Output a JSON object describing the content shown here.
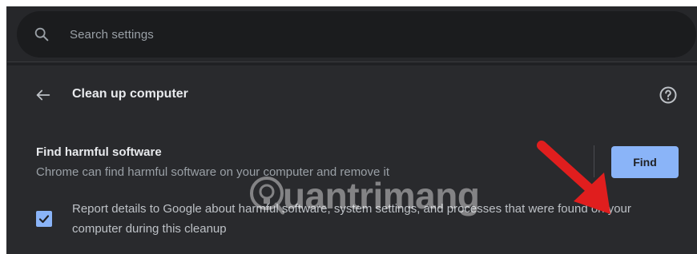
{
  "search": {
    "placeholder": "Search settings"
  },
  "page": {
    "title": "Clean up computer",
    "back_icon": "arrow-left-icon",
    "help_icon": "help-circle-icon"
  },
  "harmful_software": {
    "title": "Find harmful software",
    "description": "Chrome can find harmful software on your computer and remove it",
    "button_label": "Find"
  },
  "report": {
    "checked": true,
    "text": "Report details to Google about harmful software, system settings, and processes that were found on your computer during this cleanup"
  },
  "watermark": {
    "text": "uantrimang"
  },
  "colors": {
    "accent": "#8ab4f8",
    "background": "#202124",
    "card": "#292a2d",
    "annotation_arrow": "#e01e1e"
  }
}
